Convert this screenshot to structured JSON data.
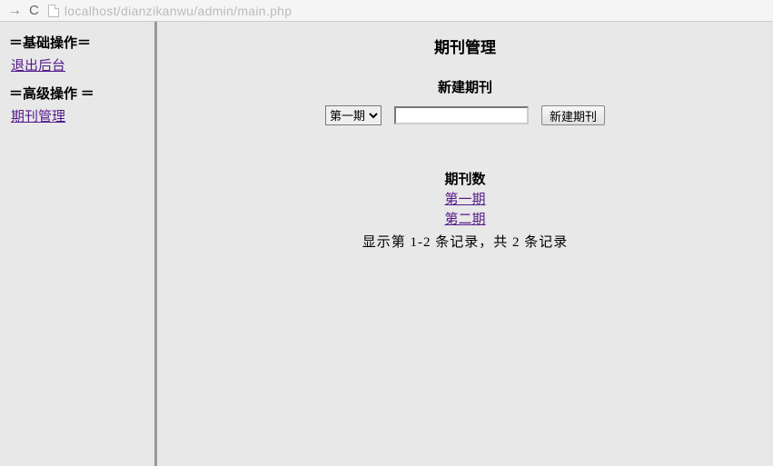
{
  "browser": {
    "url": "localhost/dianzikanwu/admin/main.php"
  },
  "sidebar": {
    "section1_title": "＝基础操作＝",
    "link1": "退出后台",
    "section2_title": "＝高级操作 ＝",
    "link2": "期刊管理"
  },
  "main": {
    "title": "期刊管理",
    "new_issue_title": "新建期刊",
    "select_options": [
      "第一期"
    ],
    "selected": "第一期",
    "input_value": "",
    "button_label": "新建期刊",
    "count_title": "期刊数",
    "issues": [
      "第一期",
      "第二期"
    ],
    "pagination": "显示第 1-2 条记录，共 2 条记录"
  }
}
